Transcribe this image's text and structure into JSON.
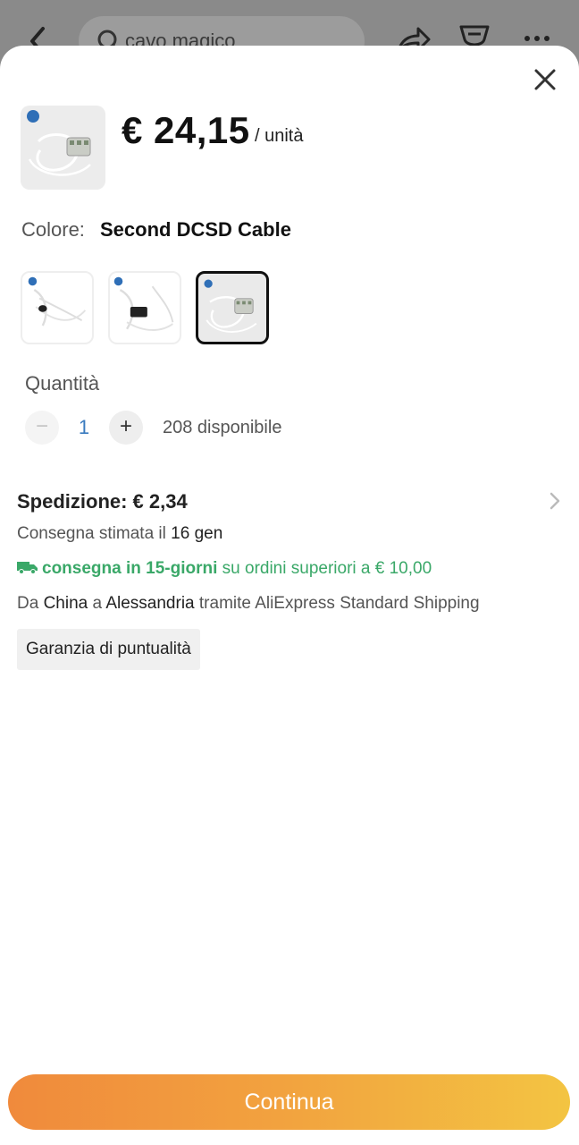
{
  "background_header": {
    "search_text": "cavo magico",
    "icons": [
      "back-arrow-icon",
      "search-icon",
      "share-icon",
      "cart-icon",
      "more-icon"
    ]
  },
  "sheet": {
    "price": "€ 24,15",
    "unit": "/ unità",
    "color_label": "Colore:",
    "color_value": "Second DCSD Cable",
    "variants_count": 3,
    "selected_variant_index": 2,
    "quantity_label": "Quantità",
    "quantity_minus": "−",
    "quantity_value": "1",
    "quantity_plus": "+",
    "available": "208 disponibile",
    "shipping_title": "Spedizione: € 2,34",
    "delivery_prefix": "Consegna stimata il",
    "delivery_date": "16 gen",
    "fast_delivery": "consegna in 15-giorni",
    "fast_delivery_suffix": "su ordini superiori a € 10,00",
    "route_from_prefix": "Da",
    "route_from": "China",
    "route_to_prefix": "a",
    "route_to": "Alessandria",
    "route_suffix": "tramite AliExpress Standard Shipping",
    "guarantee_badge": "Garanzia di puntualità",
    "cta": "Continua"
  },
  "colors": {
    "accent_green": "#3aa868",
    "cta_start": "#f08a3c",
    "cta_end": "#f3c442",
    "quantity_blue": "#3a7bbf"
  }
}
